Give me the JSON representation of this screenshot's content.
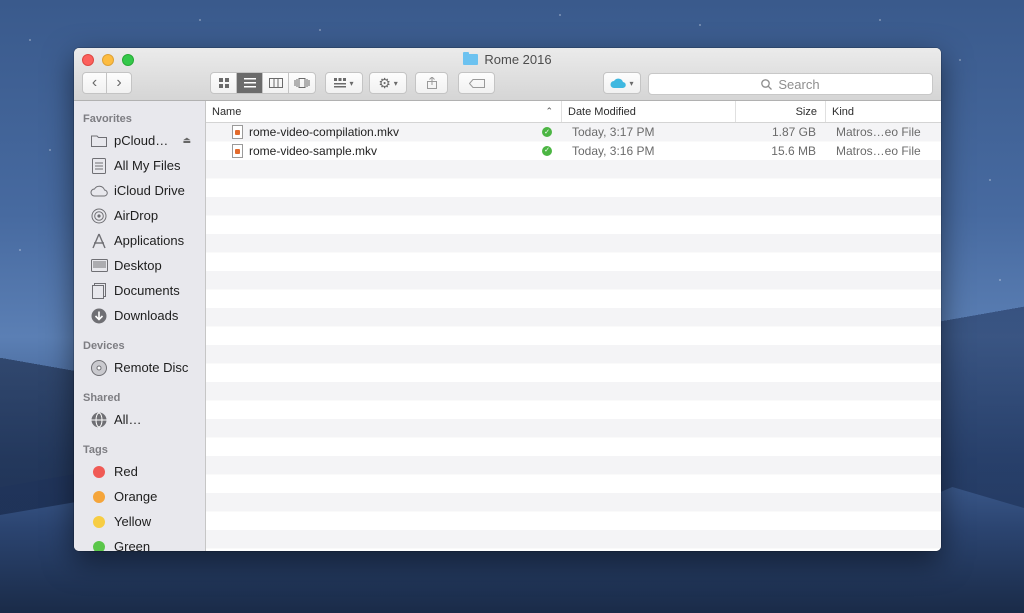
{
  "window": {
    "title": "Rome 2016"
  },
  "search": {
    "placeholder": "Search"
  },
  "sidebar": {
    "favorites_header": "Favorites",
    "favorites": [
      {
        "label": "pCloud…",
        "icon": "folder-icon"
      },
      {
        "label": "All My Files",
        "icon": "all-files-icon"
      },
      {
        "label": "iCloud Drive",
        "icon": "cloud-icon"
      },
      {
        "label": "AirDrop",
        "icon": "airdrop-icon"
      },
      {
        "label": "Applications",
        "icon": "applications-icon"
      },
      {
        "label": "Desktop",
        "icon": "desktop-icon"
      },
      {
        "label": "Documents",
        "icon": "documents-icon"
      },
      {
        "label": "Downloads",
        "icon": "downloads-icon"
      }
    ],
    "devices_header": "Devices",
    "devices": [
      {
        "label": "Remote Disc",
        "icon": "disc-icon"
      }
    ],
    "shared_header": "Shared",
    "shared": [
      {
        "label": "All…",
        "icon": "network-icon"
      }
    ],
    "tags_header": "Tags",
    "tags": [
      {
        "label": "Red",
        "color": "#f05a55"
      },
      {
        "label": "Orange",
        "color": "#f5a53a"
      },
      {
        "label": "Yellow",
        "color": "#f7cd43"
      },
      {
        "label": "Green",
        "color": "#5bc74a"
      }
    ]
  },
  "columns": {
    "name": "Name",
    "date": "Date Modified",
    "size": "Size",
    "kind": "Kind"
  },
  "files": [
    {
      "name": "rome-video-compilation.mkv",
      "date": "Today, 3:17 PM",
      "size": "1.87 GB",
      "kind": "Matros…eo File"
    },
    {
      "name": "rome-video-sample.mkv",
      "date": "Today, 3:16 PM",
      "size": "15.6 MB",
      "kind": "Matros…eo File"
    }
  ]
}
